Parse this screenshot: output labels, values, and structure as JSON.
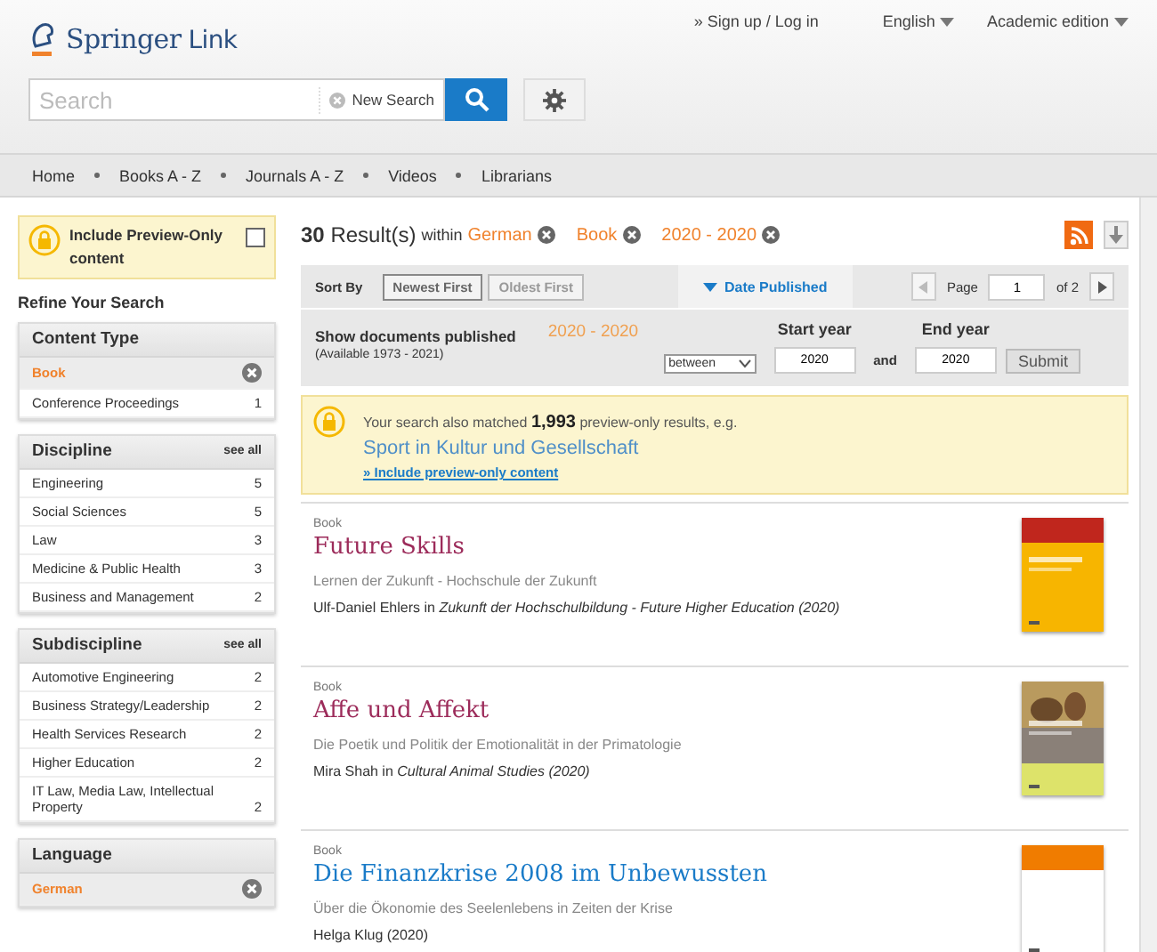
{
  "header": {
    "logo": {
      "brand": "Springer",
      "product": "Link"
    },
    "account_link": "» Sign up / Log in",
    "language": "English",
    "edition": "Academic edition",
    "search": {
      "placeholder": "Search"
    },
    "new_search": "New Search"
  },
  "nav": [
    "Home",
    "Books A - Z",
    "Journals A - Z",
    "Videos",
    "Librarians"
  ],
  "sidebar": {
    "preview": {
      "label": "Include Preview-Only content",
      "checked": false
    },
    "refine_title": "Refine Your Search",
    "facets": [
      {
        "title": "Content Type",
        "items": [
          {
            "label": "Book",
            "selected": true
          },
          {
            "label": "Conference Proceedings",
            "count": "1",
            "selected": false
          }
        ]
      },
      {
        "title": "Discipline",
        "see_all": "see all",
        "items": [
          {
            "label": "Engineering",
            "count": "5",
            "selected": false
          },
          {
            "label": "Social Sciences",
            "count": "5",
            "selected": false
          },
          {
            "label": "Law",
            "count": "3",
            "selected": false
          },
          {
            "label": "Medicine & Public Health",
            "count": "3",
            "selected": false
          },
          {
            "label": "Business and Management",
            "count": "2",
            "selected": false
          }
        ]
      },
      {
        "title": "Subdiscipline",
        "see_all": "see all",
        "items": [
          {
            "label": "Automotive Engineering",
            "count": "2",
            "selected": false
          },
          {
            "label": "Business Strategy/Leadership",
            "count": "2",
            "selected": false
          },
          {
            "label": "Health Services Research",
            "count": "2",
            "selected": false
          },
          {
            "label": "Higher Education",
            "count": "2",
            "selected": false
          },
          {
            "label": "IT Law, Media Law, Intellectual Property",
            "count": "2",
            "selected": false
          }
        ]
      },
      {
        "title": "Language",
        "items": [
          {
            "label": "German",
            "selected": true
          }
        ]
      }
    ]
  },
  "results_header": {
    "count": "30",
    "label": "Result(s)",
    "within": "within",
    "filters": [
      "German",
      "Book",
      "2020 - 2020"
    ]
  },
  "sort": {
    "label": "Sort By",
    "options": [
      {
        "label": "Newest First",
        "selected": true
      },
      {
        "label": "Oldest First",
        "selected": false
      }
    ],
    "date_tab": "Date Published",
    "pager": {
      "label": "Page",
      "value": "1",
      "of": "of 2"
    }
  },
  "date_filter": {
    "title": "Show documents published",
    "available": "(Available 1973 - 2021)",
    "range": "2020 - 2020",
    "mode": "between",
    "start_label": "Start year",
    "start": "2020",
    "and": "and",
    "end_label": "End year",
    "end": "2020",
    "submit": "Submit"
  },
  "notice": {
    "text": "Your search also matched **1,993** preview-only results, e.g.",
    "example": "Sport in Kultur und Gesellschaft",
    "link": "» Include preview-only content"
  },
  "results": [
    {
      "type": "Book",
      "title": "Future Skills",
      "visited": true,
      "subtitle": "Lernen der Zukunft - Hochschule der Zukunft",
      "byline": "Ulf-Daniel Ehlers in *Zukunft der Hochschulbildung - Future Higher Education (2020)*"
    },
    {
      "type": "Book",
      "title": "Affe und Affekt",
      "visited": true,
      "subtitle": "Die Poetik und Politik der Emotionalität in der Primatologie",
      "byline": "Mira Shah in *Cultural Animal Studies (2020)*"
    },
    {
      "type": "Book",
      "title": "Die Finanzkrise 2008 im Unbewussten",
      "visited": false,
      "subtitle": "Über die Ökonomie des Seelenlebens in Zeiten der Krise",
      "byline": "Helga Klug (2020)"
    }
  ]
}
